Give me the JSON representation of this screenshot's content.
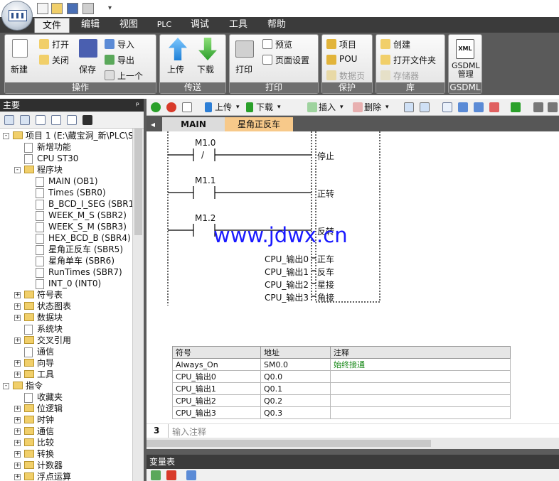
{
  "ribbon_tabs": [
    "文件",
    "编辑",
    "视图",
    "PLC",
    "调试",
    "工具",
    "帮助"
  ],
  "ribbon": {
    "ops": {
      "label": "操作",
      "new": "新建",
      "open": "打开",
      "close": "关闭",
      "save": "保存",
      "import": "导入",
      "export": "导出",
      "previous": "上一个"
    },
    "transfer": {
      "label": "传送",
      "upload": "上传",
      "download": "下载"
    },
    "print": {
      "label": "打印",
      "print": "打印",
      "preview": "预览",
      "page_setup": "页面设置"
    },
    "protect": {
      "label": "保护",
      "project": "项目",
      "pou": "POU",
      "datablock": "数据页"
    },
    "library": {
      "label": "库",
      "create": "创建",
      "open_folder": "打开文件夹",
      "memory": "存储器"
    },
    "gsdml": {
      "label": "GSDML",
      "manage": "GSDML\n管理",
      "xml": "XML"
    }
  },
  "left_panel": {
    "title": "主要",
    "pin": "ᵖ",
    "tree": [
      {
        "label": "项目 1 (E:\\藏宝洞_新\\PLC\\S",
        "level": 0,
        "exp": "-"
      },
      {
        "label": "新增功能",
        "level": 1
      },
      {
        "label": "CPU ST30",
        "level": 1
      },
      {
        "label": "程序块",
        "level": 1,
        "exp": "-"
      },
      {
        "label": "MAIN (OB1)",
        "level": 2
      },
      {
        "label": "Times (SBR0)",
        "level": 2
      },
      {
        "label": "B_BCD_I_SEG (SBR1",
        "level": 2
      },
      {
        "label": "WEEK_M_S (SBR2)",
        "level": 2
      },
      {
        "label": "WEEK_S_M (SBR3)",
        "level": 2
      },
      {
        "label": "HEX_BCD_B (SBR4)",
        "level": 2
      },
      {
        "label": "星角正反车 (SBR5)",
        "level": 2
      },
      {
        "label": "星角单车 (SBR6)",
        "level": 2
      },
      {
        "label": "RunTimes (SBR7)",
        "level": 2
      },
      {
        "label": "INT_0 (INT0)",
        "level": 2
      },
      {
        "label": "符号表",
        "level": 1,
        "exp": "+"
      },
      {
        "label": "状态图表",
        "level": 1,
        "exp": "+"
      },
      {
        "label": "数据块",
        "level": 1,
        "exp": "+"
      },
      {
        "label": "系统块",
        "level": 1
      },
      {
        "label": "交叉引用",
        "level": 1,
        "exp": "+"
      },
      {
        "label": "通信",
        "level": 1
      },
      {
        "label": "向导",
        "level": 1,
        "exp": "+"
      },
      {
        "label": "工具",
        "level": 1,
        "exp": "+"
      },
      {
        "label": "指令",
        "level": 0,
        "exp": "-"
      },
      {
        "label": "收藏夹",
        "level": 1
      },
      {
        "label": "位逻辑",
        "level": 1,
        "exp": "+"
      },
      {
        "label": "时钟",
        "level": 1,
        "exp": "+"
      },
      {
        "label": "通信",
        "level": 1,
        "exp": "+"
      },
      {
        "label": "比较",
        "level": 1,
        "exp": "+"
      },
      {
        "label": "转换",
        "level": 1,
        "exp": "+"
      },
      {
        "label": "计数器",
        "level": 1,
        "exp": "+"
      },
      {
        "label": "浮点运算",
        "level": 1,
        "exp": "+"
      }
    ]
  },
  "editor_toolbar": {
    "upload": "上传",
    "download": "下载",
    "insert": "插入",
    "delete": "删除"
  },
  "editor_tabs": {
    "main": "MAIN",
    "active": "星角正反车"
  },
  "ladder": {
    "contacts": [
      "M1.0",
      "M1.1",
      "M1.2"
    ],
    "contact_symbols": [
      "/",
      "",
      ""
    ],
    "outputs": [
      "停止",
      "正转",
      "反转"
    ],
    "cpu_rows": [
      {
        "name": "CPU_输出0",
        "coil": "正车"
      },
      {
        "name": "CPU_输出1",
        "coil": "反车"
      },
      {
        "name": "CPU_输出2",
        "coil": "星接"
      },
      {
        "name": "CPU_输出3",
        "coil": "角接"
      }
    ]
  },
  "watermark": "www.jdwx.cn",
  "symbol_table": {
    "headers": [
      "符号",
      "地址",
      "注释"
    ],
    "rows": [
      [
        "Always_On",
        "SM0.0",
        "始终接通"
      ],
      [
        "CPU_输出0",
        "Q0.0",
        ""
      ],
      [
        "CPU_输出1",
        "Q0.1",
        ""
      ],
      [
        "CPU_输出2",
        "Q0.2",
        ""
      ],
      [
        "CPU_输出3",
        "Q0.3",
        ""
      ]
    ],
    "comment_color": "#1a8a1a"
  },
  "network3": {
    "number": "3",
    "placeholder": "输入注释"
  },
  "var_table": {
    "title": "变量表"
  }
}
